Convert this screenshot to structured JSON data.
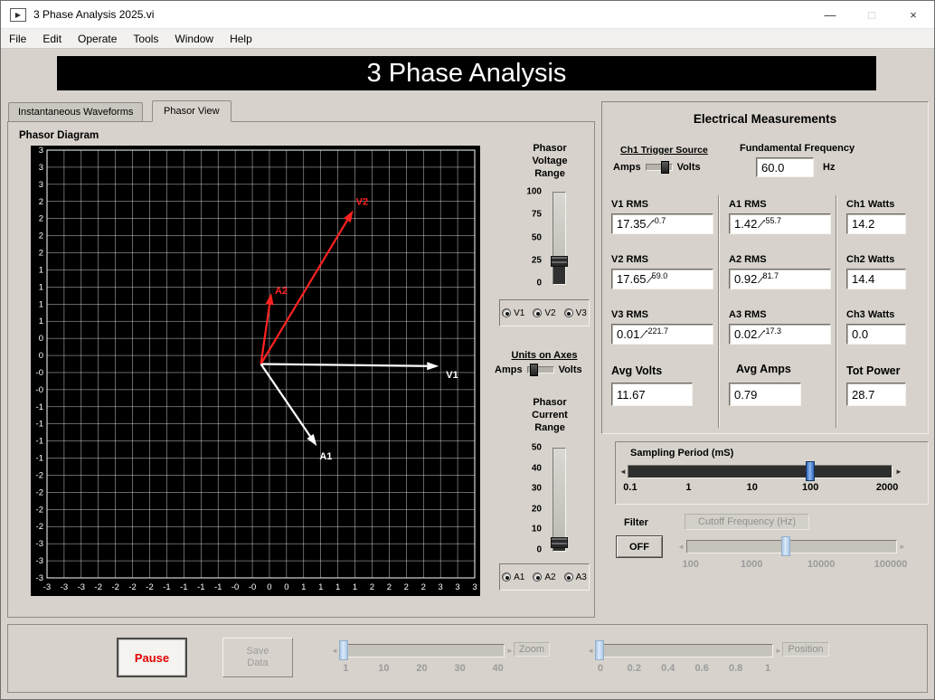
{
  "window": {
    "title": "3 Phase Analysis 2025.vi",
    "controls": {
      "minimize": "—",
      "maximize": "□",
      "close": "×"
    }
  },
  "menu": {
    "items": [
      "File",
      "Edit",
      "Operate",
      "Tools",
      "Window",
      "Help"
    ]
  },
  "banner": {
    "title": "3 Phase Analysis"
  },
  "tabs": {
    "items": [
      "Instantaneous Waveforms",
      "Phasor View"
    ],
    "active": "Phasor View"
  },
  "phasor": {
    "title": "Phasor Diagram",
    "x_labels": [
      "-3",
      "-3",
      "-3",
      "-2",
      "-2",
      "-2",
      "-2",
      "-1",
      "-1",
      "-1",
      "-1",
      "-0",
      "-0",
      "0",
      "0",
      "1",
      "1",
      "1",
      "1",
      "2",
      "2",
      "2",
      "2",
      "3",
      "3",
      "3"
    ],
    "y_labels": [
      "3",
      "3",
      "3",
      "2",
      "2",
      "2",
      "2",
      "1",
      "1",
      "1",
      "1",
      "0",
      "0",
      "-0",
      "-0",
      "-1",
      "-1",
      "-1",
      "-1",
      "-2",
      "-2",
      "-2",
      "-2",
      "-3",
      "-3",
      "-3"
    ],
    "cells_per_unit": 4,
    "arrows": [
      {
        "name": "V1",
        "angle_deg": -0.7,
        "length": 2.6,
        "color": "#ffffff",
        "label_dx": 8,
        "label_dy": 13
      },
      {
        "name": "V2",
        "angle_deg": 59.0,
        "length": 2.62,
        "color": "#ff2222",
        "label_dx": 3,
        "label_dy": -6
      },
      {
        "name": "A2",
        "angle_deg": 81.7,
        "length": 1.05,
        "color": "#ff2222",
        "label_dx": 4,
        "label_dy": 1
      },
      {
        "name": "A1",
        "angle_deg": -55.7,
        "length": 1.45,
        "color": "#ffffff",
        "label_dx": 3,
        "label_dy": 15
      }
    ]
  },
  "voltage_slider": {
    "title_lines": [
      "Phasor",
      "Voltage",
      "Range"
    ],
    "ticks": [
      "100",
      "75",
      "50",
      "25",
      "0"
    ],
    "handle_frac": 0.25,
    "radios": [
      "V1",
      "V2",
      "V3"
    ]
  },
  "units_toggle": {
    "title": "Units on Axes",
    "left": "Amps",
    "right": "Volts"
  },
  "current_slider": {
    "title_lines": [
      "Phasor",
      "Current",
      "Range"
    ],
    "ticks": [
      "50",
      "40",
      "30",
      "20",
      "10",
      "0"
    ],
    "handle_frac": 0.08,
    "radios": [
      "A1",
      "A2",
      "A3"
    ]
  },
  "measurements": {
    "title": "Electrical Measurements",
    "trigger": {
      "label": "Ch1 Trigger Source",
      "left": "Amps",
      "right": "Volts"
    },
    "frequency": {
      "label": "Fundamental Frequency",
      "value": "60.0",
      "unit": "Hz"
    },
    "voltages": [
      {
        "label": "V1 RMS",
        "value": "17.35",
        "angle": "-0.7"
      },
      {
        "label": "V2 RMS",
        "value": "17.65",
        "angle": "59.0"
      },
      {
        "label": "V3 RMS",
        "value": "0.01",
        "angle": "-221.7"
      }
    ],
    "currents": [
      {
        "label": "A1 RMS",
        "value": "1.42",
        "angle": "-55.7"
      },
      {
        "label": "A2 RMS",
        "value": "0.92",
        "angle": "81.7"
      },
      {
        "label": "A3 RMS",
        "value": "0.02",
        "angle": "-17.3"
      }
    ],
    "watts": [
      {
        "label": "Ch1 Watts",
        "value": "14.2"
      },
      {
        "label": "Ch2 Watts",
        "value": "14.4"
      },
      {
        "label": "Ch3 Watts",
        "value": "0.0"
      }
    ],
    "totals": [
      {
        "label": "Avg Volts",
        "value": "11.67"
      },
      {
        "label": "Avg Amps",
        "value": "0.79"
      },
      {
        "label": "Tot Power",
        "value": "28.7"
      }
    ]
  },
  "sampling": {
    "title": "Sampling Period (mS)",
    "ticks": [
      "0.1",
      "1",
      "10",
      "100",
      "2000"
    ],
    "tick_pos": [
      0.01,
      0.23,
      0.47,
      0.69,
      0.98
    ],
    "handle_frac": 0.69
  },
  "filter": {
    "label": "Filter",
    "button": "OFF",
    "cutoff": {
      "label": "Cutoff Frequency (Hz)",
      "ticks": [
        "100",
        "1000",
        "10000",
        "100000"
      ],
      "tick_pos": [
        0.02,
        0.31,
        0.64,
        0.97
      ],
      "handle_frac": 0.47
    }
  },
  "footer": {
    "pause": "Pause",
    "save_lines": [
      "Save",
      "Data"
    ],
    "zoom": {
      "label": "Zoom",
      "ticks": [
        "1",
        "10",
        "20",
        "30",
        "40"
      ],
      "tick_pos": [
        0.04,
        0.27,
        0.5,
        0.73,
        0.96
      ],
      "handle_frac": 0.02
    },
    "position": {
      "label": "Position",
      "ticks": [
        "0",
        "0.2",
        "0.4",
        "0.6",
        "0.8",
        "1"
      ],
      "tick_pos": [
        0.03,
        0.22,
        0.41,
        0.6,
        0.79,
        0.97
      ],
      "handle_frac": 0.02
    }
  },
  "icons": {
    "left_arrow": "◄",
    "right_arrow": "►"
  }
}
